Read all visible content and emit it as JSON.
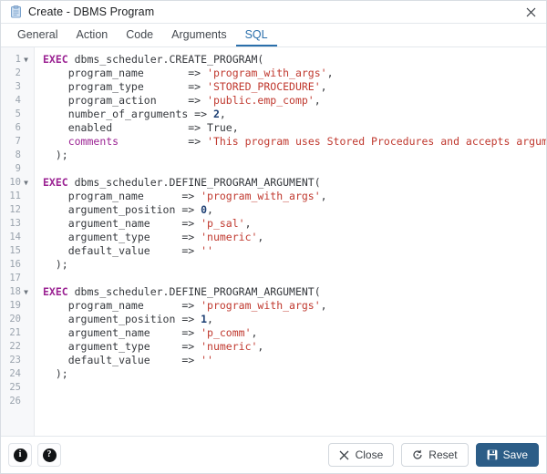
{
  "window": {
    "title": "Create - DBMS Program",
    "icon": "clipboard-icon",
    "close_label": "✕"
  },
  "tabs": [
    {
      "label": "General",
      "active": false
    },
    {
      "label": "Action",
      "active": false
    },
    {
      "label": "Code",
      "active": false
    },
    {
      "label": "Arguments",
      "active": false
    },
    {
      "label": "SQL",
      "active": true
    }
  ],
  "editor": {
    "language": "SQL",
    "total_lines": 26,
    "lines": [
      {
        "num": 1,
        "fold": "▼",
        "tokens": [
          {
            "t": "EXEC",
            "c": "kw"
          },
          {
            "t": " dbms_scheduler.CREATE_PROGRAM(",
            "c": "fn"
          }
        ]
      },
      {
        "num": 2,
        "fold": "",
        "tokens": [
          {
            "t": "    program_name       ",
            "c": "arg"
          },
          {
            "t": "=> ",
            "c": "op"
          },
          {
            "t": "'program_with_args'",
            "c": "str"
          },
          {
            "t": ",",
            "c": "punc"
          }
        ]
      },
      {
        "num": 3,
        "fold": "",
        "tokens": [
          {
            "t": "    program_type       ",
            "c": "arg"
          },
          {
            "t": "=> ",
            "c": "op"
          },
          {
            "t": "'STORED_PROCEDURE'",
            "c": "str"
          },
          {
            "t": ",",
            "c": "punc"
          }
        ]
      },
      {
        "num": 4,
        "fold": "",
        "tokens": [
          {
            "t": "    program_action     ",
            "c": "arg"
          },
          {
            "t": "=> ",
            "c": "op"
          },
          {
            "t": "'public.emp_comp'",
            "c": "str"
          },
          {
            "t": ",",
            "c": "punc"
          }
        ]
      },
      {
        "num": 5,
        "fold": "",
        "tokens": [
          {
            "t": "    number_of_arguments ",
            "c": "arg"
          },
          {
            "t": "=> ",
            "c": "op"
          },
          {
            "t": "2",
            "c": "num"
          },
          {
            "t": ",",
            "c": "punc"
          }
        ]
      },
      {
        "num": 6,
        "fold": "",
        "tokens": [
          {
            "t": "    enabled            ",
            "c": "arg"
          },
          {
            "t": "=> ",
            "c": "op"
          },
          {
            "t": "True",
            "c": "arg"
          },
          {
            "t": ",",
            "c": "punc"
          }
        ]
      },
      {
        "num": 7,
        "fold": "",
        "tokens": [
          {
            "t": "    ",
            "c": "arg"
          },
          {
            "t": "comments",
            "c": "prop"
          },
          {
            "t": "           ",
            "c": "arg"
          },
          {
            "t": "=> ",
            "c": "op"
          },
          {
            "t": "'This program uses Stored Procedures and accepts arguments.'",
            "c": "str"
          }
        ]
      },
      {
        "num": 8,
        "fold": "",
        "tokens": [
          {
            "t": "  );",
            "c": "punc"
          }
        ]
      },
      {
        "num": 9,
        "fold": "",
        "tokens": []
      },
      {
        "num": 10,
        "fold": "▼",
        "tokens": [
          {
            "t": "EXEC",
            "c": "kw"
          },
          {
            "t": " dbms_scheduler.DEFINE_PROGRAM_ARGUMENT(",
            "c": "fn"
          }
        ]
      },
      {
        "num": 11,
        "fold": "",
        "tokens": [
          {
            "t": "    program_name      ",
            "c": "arg"
          },
          {
            "t": "=> ",
            "c": "op"
          },
          {
            "t": "'program_with_args'",
            "c": "str"
          },
          {
            "t": ",",
            "c": "punc"
          }
        ]
      },
      {
        "num": 12,
        "fold": "",
        "tokens": [
          {
            "t": "    argument_position ",
            "c": "arg"
          },
          {
            "t": "=> ",
            "c": "op"
          },
          {
            "t": "0",
            "c": "num"
          },
          {
            "t": ",",
            "c": "punc"
          }
        ]
      },
      {
        "num": 13,
        "fold": "",
        "tokens": [
          {
            "t": "    argument_name     ",
            "c": "arg"
          },
          {
            "t": "=> ",
            "c": "op"
          },
          {
            "t": "'p_sal'",
            "c": "str"
          },
          {
            "t": ",",
            "c": "punc"
          }
        ]
      },
      {
        "num": 14,
        "fold": "",
        "tokens": [
          {
            "t": "    argument_type     ",
            "c": "arg"
          },
          {
            "t": "=> ",
            "c": "op"
          },
          {
            "t": "'numeric'",
            "c": "str"
          },
          {
            "t": ",",
            "c": "punc"
          }
        ]
      },
      {
        "num": 15,
        "fold": "",
        "tokens": [
          {
            "t": "    default_value     ",
            "c": "arg"
          },
          {
            "t": "=> ",
            "c": "op"
          },
          {
            "t": "''",
            "c": "str"
          }
        ]
      },
      {
        "num": 16,
        "fold": "",
        "tokens": [
          {
            "t": "  );",
            "c": "punc"
          }
        ]
      },
      {
        "num": 17,
        "fold": "",
        "tokens": []
      },
      {
        "num": 18,
        "fold": "▼",
        "tokens": [
          {
            "t": "EXEC",
            "c": "kw"
          },
          {
            "t": " dbms_scheduler.DEFINE_PROGRAM_ARGUMENT(",
            "c": "fn"
          }
        ]
      },
      {
        "num": 19,
        "fold": "",
        "tokens": [
          {
            "t": "    program_name      ",
            "c": "arg"
          },
          {
            "t": "=> ",
            "c": "op"
          },
          {
            "t": "'program_with_args'",
            "c": "str"
          },
          {
            "t": ",",
            "c": "punc"
          }
        ]
      },
      {
        "num": 20,
        "fold": "",
        "tokens": [
          {
            "t": "    argument_position ",
            "c": "arg"
          },
          {
            "t": "=> ",
            "c": "op"
          },
          {
            "t": "1",
            "c": "num"
          },
          {
            "t": ",",
            "c": "punc"
          }
        ]
      },
      {
        "num": 21,
        "fold": "",
        "tokens": [
          {
            "t": "    argument_name     ",
            "c": "arg"
          },
          {
            "t": "=> ",
            "c": "op"
          },
          {
            "t": "'p_comm'",
            "c": "str"
          },
          {
            "t": ",",
            "c": "punc"
          }
        ]
      },
      {
        "num": 22,
        "fold": "",
        "tokens": [
          {
            "t": "    argument_type     ",
            "c": "arg"
          },
          {
            "t": "=> ",
            "c": "op"
          },
          {
            "t": "'numeric'",
            "c": "str"
          },
          {
            "t": ",",
            "c": "punc"
          }
        ]
      },
      {
        "num": 23,
        "fold": "",
        "tokens": [
          {
            "t": "    default_value     ",
            "c": "arg"
          },
          {
            "t": "=> ",
            "c": "op"
          },
          {
            "t": "''",
            "c": "str"
          }
        ]
      },
      {
        "num": 24,
        "fold": "",
        "tokens": [
          {
            "t": "  );",
            "c": "punc"
          }
        ]
      },
      {
        "num": 25,
        "fold": "",
        "tokens": []
      },
      {
        "num": 26,
        "fold": "",
        "tokens": []
      }
    ]
  },
  "footer": {
    "info_label": "i",
    "help_label": "?",
    "close_label": "Close",
    "reset_label": "Reset",
    "save_label": "Save"
  },
  "colors": {
    "accent": "#2a6fab",
    "primary_button": "#2c5d87",
    "keyword": "#9b2393",
    "string": "#c0392f",
    "number": "#1d3f73",
    "text": "#35383d",
    "gutter_text": "#9aa3ad"
  }
}
